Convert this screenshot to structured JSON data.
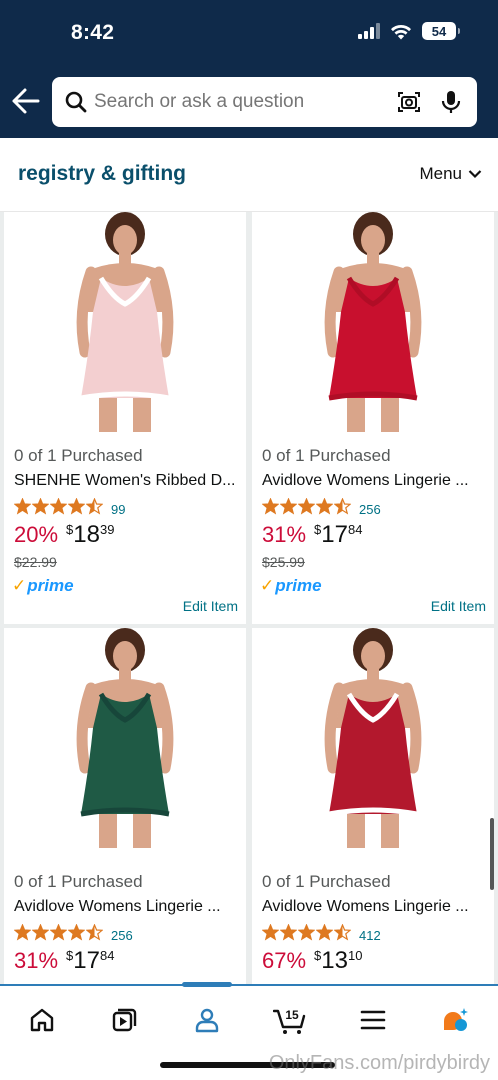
{
  "status": {
    "time": "8:42",
    "battery": "54"
  },
  "search": {
    "placeholder": "Search or ask a question"
  },
  "registry": {
    "title": "registry & gifting",
    "menu_label": "Menu"
  },
  "products": [
    {
      "purchased": "0 of 1 Purchased",
      "title": "SHENHE Women's Ribbed D...",
      "rating": 4.5,
      "rating_count": "99",
      "discount": "20%",
      "price_symbol": "$",
      "price_whole": "18",
      "price_fraction": "39",
      "list_price": "$22.99",
      "prime": "prime",
      "edit_label": "Edit Item",
      "dress_color": "#f3cfd0",
      "lace_color": "#ffffff"
    },
    {
      "purchased": "0 of 1 Purchased",
      "title": "Avidlove Womens Lingerie ...",
      "rating": 4.5,
      "rating_count": "256",
      "discount": "31%",
      "price_symbol": "$",
      "price_whole": "17",
      "price_fraction": "84",
      "list_price": "$25.99",
      "prime": "prime",
      "edit_label": "Edit Item",
      "dress_color": "#c8102e",
      "lace_color": "#b00d26"
    },
    {
      "purchased": "0 of 1 Purchased",
      "title": "Avidlove Womens Lingerie ...",
      "rating": 4.5,
      "rating_count": "256",
      "discount": "31%",
      "price_symbol": "$",
      "price_whole": "17",
      "price_fraction": "84",
      "dress_color": "#1f5a45",
      "lace_color": "#17463a"
    },
    {
      "purchased": "0 of 1 Purchased",
      "title": "Avidlove Womens Lingerie ...",
      "rating": 4.5,
      "rating_count": "412",
      "discount": "67%",
      "price_symbol": "$",
      "price_whole": "13",
      "price_fraction": "10",
      "dress_color": "#b3182d",
      "lace_color": "#ffffff"
    }
  ],
  "nav": {
    "items": [
      "home-icon",
      "video-icon",
      "profile-icon",
      "cart-icon",
      "menu-icon",
      "ai-assistant-icon"
    ],
    "cart_count": "15"
  },
  "watermark": "OnlyFans.com/pirdybirdy",
  "colors": {
    "header": "#0f2a4a",
    "link": "#007185",
    "discount": "#cc0c39",
    "star": "#de7921",
    "accent": "#2e7db8"
  }
}
